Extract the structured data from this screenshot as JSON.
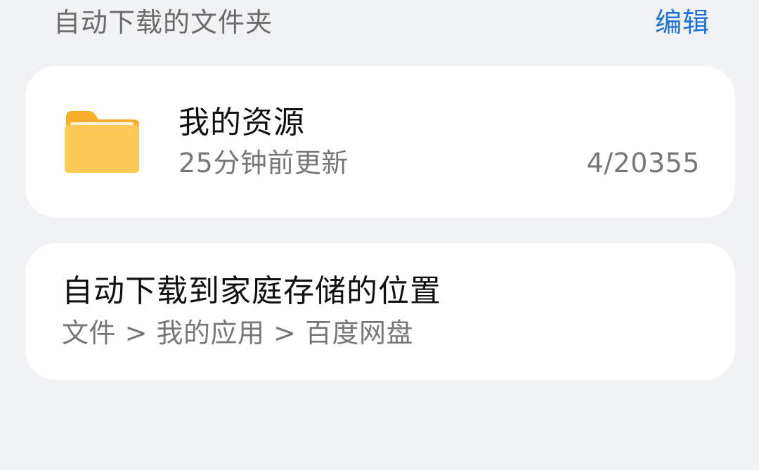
{
  "header": {
    "title": "自动下载的文件夹",
    "edit_label": "编辑"
  },
  "folder": {
    "icon": "folder-icon",
    "name": "我的资源",
    "updated": "25分钟前更新",
    "count": "4/20355"
  },
  "download_location": {
    "title": "自动下载到家庭存储的位置",
    "path": "文件 > 我的应用 > 百度网盘"
  },
  "colors": {
    "background": "#f1f2f4",
    "card": "#ffffff",
    "accent": "#1f6fd8",
    "folder_yellow": "#ffc857",
    "folder_tab": "#f7b02b",
    "secondary_text": "#777777"
  }
}
